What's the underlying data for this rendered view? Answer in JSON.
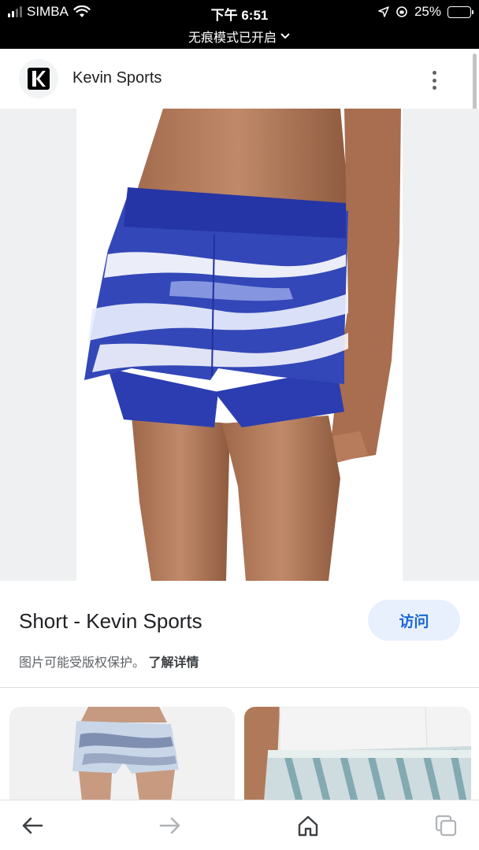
{
  "status_bar": {
    "carrier": "SIMBA",
    "time": "下午 6:51",
    "battery_percent": "25%",
    "battery_level": 0.25,
    "incognito_label": "无痕模式已开启"
  },
  "header": {
    "site_name": "Kevin Sports",
    "logo_icon": "kevin-sports-logo-icon",
    "menu_icon": "more-vert-icon"
  },
  "image": {
    "subject": "blue-white-running-shorts"
  },
  "info": {
    "title": "Short - Kevin Sports",
    "visit_label": "访问",
    "copyright_notice": "图片可能受版权保护。",
    "learn_more": "了解详情"
  },
  "related": [
    {
      "thumb": "patterned-shorts-thumbnail"
    },
    {
      "thumb": "striped-shorts-thumbnail"
    }
  ],
  "bottom_nav": {
    "items": [
      "back-arrow-icon",
      "forward-arrow-icon",
      "home-icon",
      "tabs-icon"
    ]
  },
  "colors": {
    "accent": "#1967d2",
    "visit_bg": "#e8f0fe",
    "short_blue": "#2b3db0",
    "battery": "#f5c518"
  }
}
